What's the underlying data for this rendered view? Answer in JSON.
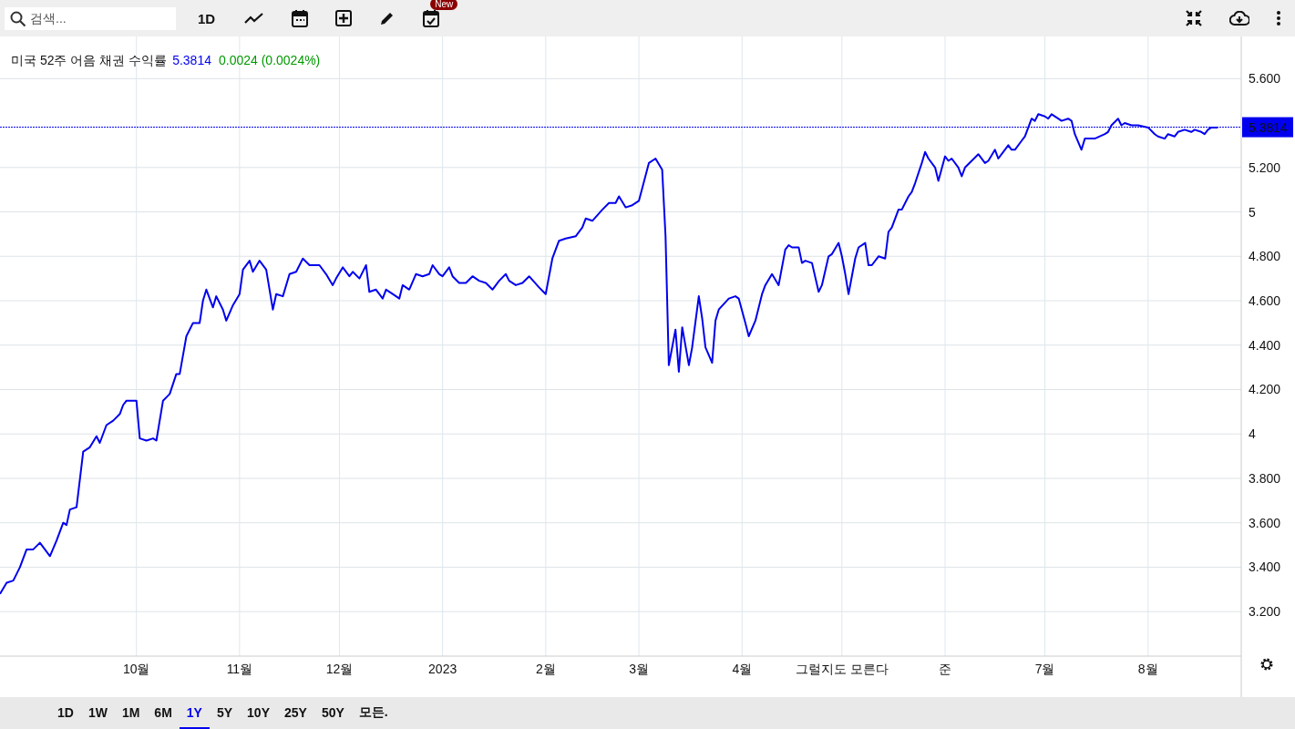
{
  "toolbar": {
    "search": {
      "placeholder": "검색..."
    },
    "interval": "1D",
    "new_badge": "New"
  },
  "legend": {
    "price": "5.3814",
    "change": "0.0024 (0.0024%)"
  },
  "price_label": "5.3814",
  "chart": {
    "chart_data": {
      "type": "line",
      "grid": true,
      "ref_lines": [
        {
          "axis": "y",
          "value": 5.3814,
          "color": "#0000ee"
        }
      ],
      "xlim": [
        "2022-08-21",
        "2023-08-29"
      ],
      "ylim": [
        2.815,
        5.79
      ],
      "xticks": [
        {
          "value": "2022-10-01",
          "label": "10월"
        },
        {
          "value": "2022-11-01",
          "label": "11월"
        },
        {
          "value": "2022-12-01",
          "label": "12월"
        },
        {
          "value": "2023-01-01",
          "label": "2023"
        },
        {
          "value": "2023-02-01",
          "label": "2월"
        },
        {
          "value": "2023-03-01",
          "label": "3월"
        },
        {
          "value": "2023-04-01",
          "label": "4월"
        },
        {
          "value": "2023-05-01",
          "label": "그럴지도 모른다"
        },
        {
          "value": "2023-06-01",
          "label": "준"
        },
        {
          "value": "2023-07-01",
          "label": "7월"
        },
        {
          "value": "2023-08-01",
          "label": "8월"
        }
      ],
      "yticks": [
        {
          "value": 3.2,
          "label": "3.200"
        },
        {
          "value": 3.4,
          "label": "3.400"
        },
        {
          "value": 3.6,
          "label": "3.600"
        },
        {
          "value": 3.8,
          "label": "3.800"
        },
        {
          "value": 4,
          "label": "4"
        },
        {
          "value": 4.2,
          "label": "4.200"
        },
        {
          "value": 4.4,
          "label": "4.400"
        },
        {
          "value": 4.6,
          "label": "4.600"
        },
        {
          "value": 4.8,
          "label": "4.800"
        },
        {
          "value": 5,
          "label": "5"
        },
        {
          "value": 5.2,
          "label": "5.200"
        },
        {
          "value": 5.6,
          "label": "5.600"
        }
      ],
      "x": [
        "2022-08-21",
        "2022-08-23",
        "2022-08-25",
        "2022-08-27",
        "2022-08-29",
        "2022-08-31",
        "2022-09-02",
        "2022-09-04",
        "2022-09-05",
        "2022-09-07",
        "2022-09-09",
        "2022-09-10",
        "2022-09-11",
        "2022-09-13",
        "2022-09-15",
        "2022-09-17",
        "2022-09-19",
        "2022-09-20",
        "2022-09-22",
        "2022-09-24",
        "2022-09-26",
        "2022-09-27",
        "2022-09-28",
        "2022-10-01",
        "2022-10-02",
        "2022-10-04",
        "2022-10-06",
        "2022-10-07",
        "2022-10-09",
        "2022-10-11",
        "2022-10-13",
        "2022-10-14",
        "2022-10-16",
        "2022-10-18",
        "2022-10-20",
        "2022-10-21",
        "2022-10-22",
        "2022-10-24",
        "2022-10-25",
        "2022-10-27",
        "2022-10-28",
        "2022-10-30",
        "2022-11-01",
        "2022-11-02",
        "2022-11-04",
        "2022-11-05",
        "2022-11-07",
        "2022-11-09",
        "2022-11-11",
        "2022-11-12",
        "2022-11-14",
        "2022-11-16",
        "2022-11-18",
        "2022-11-20",
        "2022-11-22",
        "2022-11-25",
        "2022-11-27",
        "2022-11-29",
        "2022-11-30",
        "2022-12-02",
        "2022-12-04",
        "2022-12-05",
        "2022-12-07",
        "2022-12-09",
        "2022-12-10",
        "2022-12-12",
        "2022-12-14",
        "2022-12-15",
        "2022-12-17",
        "2022-12-19",
        "2022-12-20",
        "2022-12-22",
        "2022-12-24",
        "2022-12-26",
        "2022-12-28",
        "2022-12-29",
        "2022-12-31",
        "2023-01-01",
        "2023-01-03",
        "2023-01-04",
        "2023-01-06",
        "2023-01-08",
        "2023-01-10",
        "2023-01-12",
        "2023-01-14",
        "2023-01-16",
        "2023-01-18",
        "2023-01-20",
        "2023-01-21",
        "2023-01-23",
        "2023-01-25",
        "2023-01-27",
        "2023-01-30",
        "2023-02-01",
        "2023-02-03",
        "2023-02-05",
        "2023-02-07",
        "2023-02-10",
        "2023-02-12",
        "2023-02-13",
        "2023-02-15",
        "2023-02-18",
        "2023-02-20",
        "2023-02-22",
        "2023-02-23",
        "2023-02-25",
        "2023-02-27",
        "2023-03-01",
        "2023-03-04",
        "2023-03-06",
        "2023-03-08",
        "2023-03-09",
        "2023-03-10",
        "2023-03-12",
        "2023-03-13",
        "2023-03-14",
        "2023-03-16",
        "2023-03-17",
        "2023-03-19",
        "2023-03-20",
        "2023-03-21",
        "2023-03-23",
        "2023-03-24",
        "2023-03-25",
        "2023-03-28",
        "2023-03-30",
        "2023-03-31",
        "2023-04-02",
        "2023-04-03",
        "2023-04-05",
        "2023-04-07",
        "2023-04-08",
        "2023-04-10",
        "2023-04-12",
        "2023-04-14",
        "2023-04-15",
        "2023-04-16",
        "2023-04-18",
        "2023-04-19",
        "2023-04-20",
        "2023-04-22",
        "2023-04-24",
        "2023-04-25",
        "2023-04-27",
        "2023-04-28",
        "2023-04-30",
        "2023-05-01",
        "2023-05-02",
        "2023-05-03",
        "2023-05-05",
        "2023-05-06",
        "2023-05-08",
        "2023-05-09",
        "2023-05-10",
        "2023-05-12",
        "2023-05-14",
        "2023-05-15",
        "2023-05-16",
        "2023-05-18",
        "2023-05-19",
        "2023-05-21",
        "2023-05-22",
        "2023-05-23",
        "2023-05-25",
        "2023-05-26",
        "2023-05-27",
        "2023-05-29",
        "2023-05-30",
        "2023-06-01",
        "2023-06-02",
        "2023-06-03",
        "2023-06-05",
        "2023-06-06",
        "2023-06-07",
        "2023-06-09",
        "2023-06-11",
        "2023-06-13",
        "2023-06-14",
        "2023-06-16",
        "2023-06-17",
        "2023-06-18",
        "2023-06-20",
        "2023-06-21",
        "2023-06-22",
        "2023-06-24",
        "2023-06-25",
        "2023-06-27",
        "2023-06-28",
        "2023-06-29",
        "2023-07-01",
        "2023-07-02",
        "2023-07-03",
        "2023-07-05",
        "2023-07-06",
        "2023-07-08",
        "2023-07-09",
        "2023-07-10",
        "2023-07-12",
        "2023-07-13",
        "2023-07-14",
        "2023-07-16",
        "2023-07-19",
        "2023-07-20",
        "2023-07-21",
        "2023-07-23",
        "2023-07-24",
        "2023-07-25",
        "2023-07-27",
        "2023-07-28",
        "2023-07-29",
        "2023-08-01",
        "2023-08-03",
        "2023-08-04",
        "2023-08-06",
        "2023-08-07",
        "2023-08-09",
        "2023-08-10",
        "2023-08-12",
        "2023-08-14",
        "2023-08-15",
        "2023-08-17",
        "2023-08-18",
        "2023-08-19",
        "2023-08-20",
        "2023-08-22"
      ],
      "series": [
        {
          "name": "미국 52주 어음 채권 수익률",
          "color": "#0000ee",
          "values": [
            3.28,
            3.33,
            3.34,
            3.4,
            3.48,
            3.48,
            3.51,
            3.47,
            3.45,
            3.52,
            3.6,
            3.59,
            3.66,
            3.67,
            3.92,
            3.94,
            3.99,
            3.96,
            4.04,
            4.06,
            4.09,
            4.13,
            4.15,
            4.15,
            3.98,
            3.97,
            3.98,
            3.97,
            4.15,
            4.18,
            4.27,
            4.27,
            4.44,
            4.5,
            4.5,
            4.6,
            4.65,
            4.57,
            4.62,
            4.56,
            4.51,
            4.58,
            4.63,
            4.74,
            4.78,
            4.73,
            4.78,
            4.74,
            4.56,
            4.63,
            4.62,
            4.72,
            4.73,
            4.79,
            4.76,
            4.76,
            4.72,
            4.67,
            4.7,
            4.75,
            4.71,
            4.73,
            4.7,
            4.76,
            4.64,
            4.65,
            4.61,
            4.65,
            4.63,
            4.61,
            4.67,
            4.65,
            4.72,
            4.71,
            4.72,
            4.76,
            4.72,
            4.71,
            4.75,
            4.71,
            4.68,
            4.68,
            4.71,
            4.69,
            4.68,
            4.65,
            4.69,
            4.72,
            4.69,
            4.67,
            4.68,
            4.71,
            4.66,
            4.63,
            4.79,
            4.87,
            4.88,
            4.89,
            4.93,
            4.97,
            4.96,
            5.01,
            5.04,
            5.04,
            5.07,
            5.02,
            5.03,
            5.05,
            5.22,
            5.24,
            5.19,
            4.89,
            4.31,
            4.47,
            4.28,
            4.48,
            4.31,
            4.39,
            4.62,
            4.52,
            4.39,
            4.32,
            4.51,
            4.56,
            4.61,
            4.62,
            4.61,
            4.5,
            4.44,
            4.51,
            4.63,
            4.67,
            4.72,
            4.67,
            4.83,
            4.85,
            4.84,
            4.84,
            4.77,
            4.78,
            4.77,
            4.64,
            4.67,
            4.8,
            4.81,
            4.86,
            4.8,
            4.72,
            4.63,
            4.79,
            4.84,
            4.86,
            4.76,
            4.76,
            4.8,
            4.79,
            4.91,
            4.93,
            5.01,
            5.01,
            5.07,
            5.09,
            5.13,
            5.22,
            5.27,
            5.24,
            5.2,
            5.14,
            5.25,
            5.23,
            5.24,
            5.2,
            5.16,
            5.2,
            5.23,
            5.26,
            5.22,
            5.23,
            5.28,
            5.24,
            5.26,
            5.3,
            5.28,
            5.28,
            5.32,
            5.34,
            5.42,
            5.41,
            5.44,
            5.43,
            5.42,
            5.44,
            5.42,
            5.41,
            5.42,
            5.41,
            5.35,
            5.28,
            5.33,
            5.33,
            5.33,
            5.35,
            5.36,
            5.39,
            5.42,
            5.39,
            5.4,
            5.39,
            5.39,
            5.39,
            5.38,
            5.35,
            5.34,
            5.33,
            5.35,
            5.34,
            5.36,
            5.37,
            5.36,
            5.37,
            5.36,
            5.35,
            5.37,
            5.38,
            5.38
          ]
        }
      ]
    }
  },
  "ranges": [
    {
      "label": "1D",
      "selected": false
    },
    {
      "label": "1W",
      "selected": false
    },
    {
      "label": "1M",
      "selected": false
    },
    {
      "label": "6M",
      "selected": false
    },
    {
      "label": "1Y",
      "selected": true
    },
    {
      "label": "5Y",
      "selected": false
    },
    {
      "label": "10Y",
      "selected": false
    },
    {
      "label": "25Y",
      "selected": false
    },
    {
      "label": "50Y",
      "selected": false
    },
    {
      "label": "모든.",
      "selected": false
    }
  ]
}
